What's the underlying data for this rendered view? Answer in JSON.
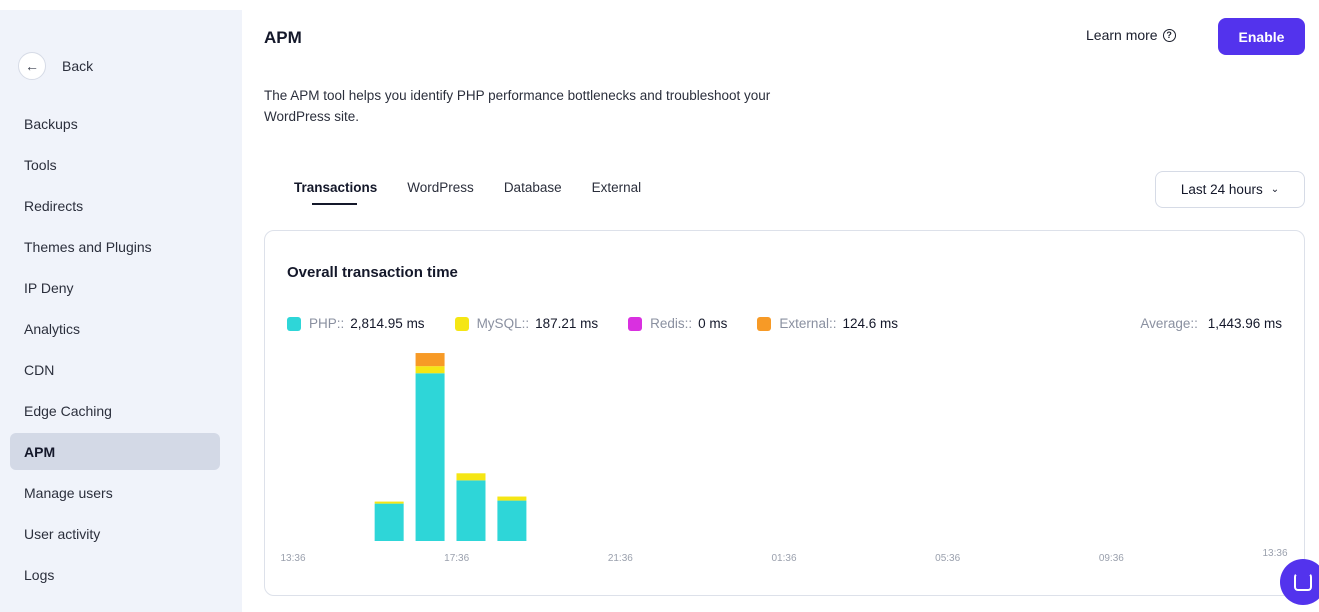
{
  "sidebar": {
    "back_label": "Back",
    "items": [
      {
        "label": "Backups",
        "active": false
      },
      {
        "label": "Tools",
        "active": false
      },
      {
        "label": "Redirects",
        "active": false
      },
      {
        "label": "Themes and Plugins",
        "active": false
      },
      {
        "label": "IP Deny",
        "active": false
      },
      {
        "label": "Analytics",
        "active": false
      },
      {
        "label": "CDN",
        "active": false
      },
      {
        "label": "Edge Caching",
        "active": false
      },
      {
        "label": "APM",
        "active": true
      },
      {
        "label": "Manage users",
        "active": false
      },
      {
        "label": "User activity",
        "active": false
      },
      {
        "label": "Logs",
        "active": false
      }
    ]
  },
  "header": {
    "title": "APM",
    "learn_more": "Learn more",
    "enable_label": "Enable",
    "description": "The APM tool helps you identify PHP performance bottlenecks and troubleshoot your WordPress site."
  },
  "tabs": [
    {
      "label": "Transactions",
      "active": true
    },
    {
      "label": "WordPress",
      "active": false
    },
    {
      "label": "Database",
      "active": false
    },
    {
      "label": "External",
      "active": false
    }
  ],
  "range": {
    "selected": "Last 24 hours"
  },
  "card": {
    "title": "Overall transaction time",
    "legend": [
      {
        "label": "PHP::",
        "value": "2,814.95 ms",
        "color": "#2ed6d8"
      },
      {
        "label": "MySQL::",
        "value": "187.21 ms",
        "color": "#f5e614"
      },
      {
        "label": "Redis::",
        "value": "0 ms",
        "color": "#d930e0"
      },
      {
        "label": "External::",
        "value": "124.6 ms",
        "color": "#f79a26"
      }
    ],
    "average_label": "Average::",
    "average_value": "1,443.96 ms"
  },
  "chart_data": {
    "type": "bar",
    "stacked": true,
    "x_ticks": [
      "13:36",
      "17:36",
      "21:36",
      "01:36",
      "05:36",
      "09:36",
      "13:36"
    ],
    "bars": [
      {
        "x": 2.35,
        "PHP": 370,
        "MySQL": 20,
        "Redis": 0,
        "External": 0
      },
      {
        "x": 3.35,
        "PHP": 1660,
        "MySQL": 70,
        "Redis": 0,
        "External": 130
      },
      {
        "x": 4.35,
        "PHP": 600,
        "MySQL": 70,
        "Redis": 0,
        "External": 0
      },
      {
        "x": 5.35,
        "PHP": 400,
        "MySQL": 40,
        "Redis": 0,
        "External": 0
      }
    ],
    "series": [
      {
        "name": "PHP",
        "color": "#2ed6d8"
      },
      {
        "name": "MySQL",
        "color": "#f5e614"
      },
      {
        "name": "Redis",
        "color": "#d930e0"
      },
      {
        "name": "External",
        "color": "#f79a26"
      }
    ],
    "x_range": [
      0,
      24
    ],
    "y_range": [
      0,
      1900
    ],
    "grid": false
  }
}
